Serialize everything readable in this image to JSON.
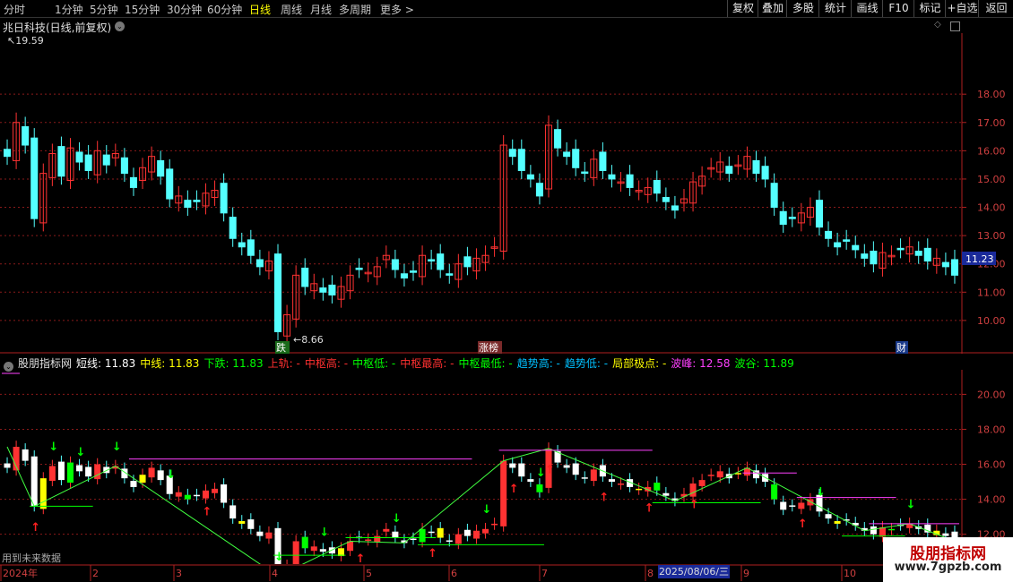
{
  "toolbar": {
    "periods": [
      "分时",
      "1分钟",
      "5分钟",
      "15分钟",
      "30分钟",
      "60分钟",
      "日线",
      "周线",
      "月线",
      "多周期",
      "更多 >"
    ],
    "active_period": "日线",
    "right_buttons": [
      "复权",
      "叠加",
      "多股",
      "统计",
      "画线",
      "F10",
      "标记",
      "+自选",
      "返回"
    ]
  },
  "stock": {
    "title": "兆日科技(日线,前复权)",
    "high_label": "19.59",
    "low_label": "8.66",
    "current_price": "11.23",
    "markers": {
      "die": "跌",
      "zhangbang": "涨榜",
      "cai": "财"
    }
  },
  "main_axis": {
    "ticks": [
      "18.00",
      "17.00",
      "16.00",
      "15.00",
      "14.00",
      "13.00",
      "12.00",
      "11.00",
      "10.00"
    ]
  },
  "indicator": {
    "name": "股朋指标网",
    "fields": [
      {
        "label": "短线:",
        "value": "11.83",
        "color": "#ffffff"
      },
      {
        "label": "中线:",
        "value": "11.83",
        "color": "#ffff00"
      },
      {
        "label": "下跌:",
        "value": "11.83",
        "color": "#00ff00"
      },
      {
        "label": "上轨:",
        "value": "-",
        "color": "#ff3030"
      },
      {
        "label": "中枢高:",
        "value": "-",
        "color": "#ff3030"
      },
      {
        "label": "中枢低:",
        "value": "-",
        "color": "#00ff00"
      },
      {
        "label": "中枢最高:",
        "value": "-",
        "color": "#ff3030"
      },
      {
        "label": "中枢最低:",
        "value": "-",
        "color": "#00ff00"
      },
      {
        "label": "趋势高:",
        "value": "-",
        "color": "#00c0ff"
      },
      {
        "label": "趋势低:",
        "value": "-",
        "color": "#00c0ff"
      },
      {
        "label": "局部极点:",
        "value": "-",
        "color": "#ffff00"
      },
      {
        "label": "波峰:",
        "value": "12.58",
        "color": "#ff40ff"
      },
      {
        "label": "波谷:",
        "value": "11.89",
        "color": "#00ff00"
      }
    ]
  },
  "ind_axis": {
    "ticks": [
      "20.00",
      "18.00",
      "16.00",
      "14.00",
      "12.00"
    ]
  },
  "future_note": "用到未来数据",
  "time_axis": {
    "labels": [
      "2024年",
      "2",
      "3",
      "4",
      "5",
      "6",
      "7",
      "8",
      "9",
      "10"
    ],
    "selected_date": "2025/08/06/三"
  },
  "watermark": {
    "line1": "股朋指标网",
    "line2": "www.7gpzb.com"
  },
  "colors": {
    "up": "#ff3232",
    "down": "#54ffff",
    "grid": "#8a1a1a",
    "axis": "#b02020"
  },
  "chart_data": {
    "type": "candlestick",
    "ylim": [
      9.3,
      20.0
    ],
    "ind_ylim": [
      10.6,
      21.3
    ],
    "close_series": [
      15.8,
      17.0,
      16.2,
      13.6,
      15.2,
      15.9,
      15.1,
      16.1,
      15.6,
      15.3,
      16.0,
      15.5,
      15.9,
      15.2,
      14.7,
      15.4,
      15.8,
      15.1,
      14.3,
      14.4,
      14.0,
      14.2,
      14.5,
      14.6,
      13.8,
      12.9,
      12.6,
      12.3,
      11.9,
      12.1,
      9.6,
      10.2,
      11.6,
      11.2,
      11.3,
      11.0,
      10.9,
      11.2,
      11.6,
      11.8,
      11.7,
      11.9,
      12.3,
      11.8,
      11.5,
      11.7,
      12.3,
      12.1,
      11.8,
      11.6,
      12.0,
      11.9,
      12.2,
      12.3,
      12.6,
      16.2,
      15.8,
      15.3,
      15.0,
      14.4,
      16.9,
      16.1,
      15.8,
      15.4,
      15.2,
      15.7,
      15.3,
      15.0,
      14.9,
      14.7,
      14.6,
      14.7,
      14.5,
      14.2,
      13.9,
      14.3,
      14.9,
      15.1,
      15.4,
      15.6,
      15.2,
      15.5,
      15.8,
      15.2,
      15.0,
      14.0,
      13.4,
      13.6,
      13.8,
      14.0,
      13.3,
      12.9,
      12.6,
      12.8,
      12.5,
      12.2,
      12.0,
      12.4,
      12.3,
      12.5,
      12.6,
      12.3,
      12.1,
      12.2,
      11.9,
      11.6
    ]
  }
}
